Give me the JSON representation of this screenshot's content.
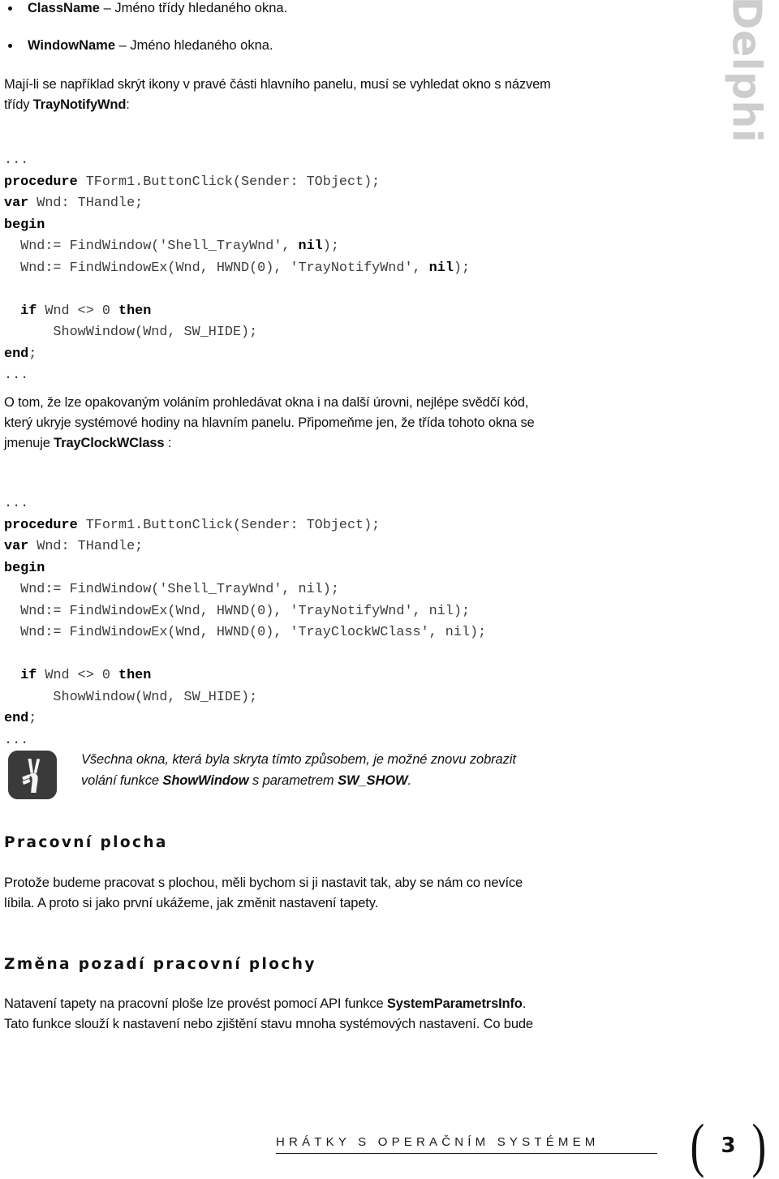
{
  "brand": {
    "vertical_label": "Delphi",
    "color": "#cdcdcd"
  },
  "bullets": [
    {
      "term": "ClassName",
      "dash": " – ",
      "desc": "Jméno třídy hledaného okna."
    },
    {
      "term": "WindowName",
      "dash": " – ",
      "desc": "Jméno hledaného okna."
    }
  ],
  "intro": {
    "line1": "Mají-li se například skrýt ikony v pravé části hlavního panelu, musí se vyhledat okno s názvem",
    "line2_prefix": "třídy ",
    "line2_term": "TrayNotifyWnd",
    "line2_suffix": ":"
  },
  "code_block_1": {
    "ellipsis_top": "...",
    "lines": [
      {
        "bold": "procedure",
        "rest": " TForm1.ButtonClick(Sender: TObject);"
      },
      {
        "bold": "var",
        "rest": " Wnd: THandle;"
      },
      {
        "bold": "begin",
        "rest": ""
      },
      {
        "bold": "",
        "rest": "  Wnd:= FindWindow('Shell_TrayWnd', ",
        "bold2": "nil",
        "rest2": ");"
      },
      {
        "bold": "",
        "rest": "  Wnd:= FindWindowEx(Wnd, HWND(0), 'TrayNotifyWnd', ",
        "bold2": "nil",
        "rest2": ");"
      },
      {
        "bold": "",
        "rest": ""
      },
      {
        "bold": "  if",
        "rest": " Wnd <> 0 ",
        "bold2": "then",
        "rest2": ""
      },
      {
        "bold": "",
        "rest": "      ShowWindow(Wnd, SW_HIDE);"
      },
      {
        "bold": "end",
        "rest": ";"
      }
    ],
    "ellipsis_bottom": "..."
  },
  "middle_paragraph": {
    "line1": "O tom, že lze opakovaným voláním prohledávat okna i na další úrovni, nejlépe svědčí kód,",
    "line2": "který ukryje systémové hodiny na hlavním panelu. Připomeňme jen, že třída tohoto okna se",
    "line3_prefix": "jmenuje ",
    "line3_term": "TrayClockWClass",
    "line3_suffix": " :"
  },
  "code_block_2": {
    "ellipsis_top": "...",
    "lines": [
      {
        "bold": "procedure",
        "rest": " TForm1.ButtonClick(Sender: TObject);"
      },
      {
        "bold": "var",
        "rest": " Wnd: THandle;"
      },
      {
        "bold": "begin",
        "rest": ""
      },
      {
        "bold": "",
        "rest": "  Wnd:= FindWindow('Shell_TrayWnd', nil);"
      },
      {
        "bold": "",
        "rest": "  Wnd:= FindWindowEx(Wnd, HWND(0), 'TrayNotifyWnd', nil);"
      },
      {
        "bold": "",
        "rest": "  Wnd:= FindWindowEx(Wnd, HWND(0), 'TrayClockWClass', nil);"
      },
      {
        "bold": "",
        "rest": ""
      },
      {
        "bold": "  if",
        "rest": " Wnd <> 0 ",
        "bold2": "then",
        "rest2": ""
      },
      {
        "bold": "",
        "rest": "      ShowWindow(Wnd, SW_HIDE);"
      },
      {
        "bold": "end",
        "rest": ";"
      }
    ],
    "ellipsis_bottom": "..."
  },
  "note": {
    "icon": "hand-victory-icon",
    "icon_bg": "#3a3a3a",
    "line1": "Všechna okna, která byla skryta tímto způsobem, je možné znovu zobrazit",
    "line2_prefix": "volání funkce ",
    "line2_term1": "ShowWindow",
    "line2_mid": " s parametrem ",
    "line2_term2": "SW_SHOW",
    "line2_suffix": "."
  },
  "section_1": {
    "heading": "Pracovní plocha",
    "line1": "Protože budeme pracovat s plochou, měli bychom si ji nastavit tak, aby se nám co nevíce",
    "line2": "líbila. A proto si jako první ukážeme, jak změnit nastavení tapety."
  },
  "section_2": {
    "heading": "Změna pozadí pracovní plochy",
    "line1_prefix": "Natavení tapety na pracovní ploše lze provést pomocí API funkce ",
    "line1_term": "SystemParametrsInfo",
    "line1_suffix": ".",
    "line2": "Tato funkce slouží k nastavení nebo zjištění stavu mnoha systémových nastavení. Co bude"
  },
  "footer": {
    "title": "HRÁTKY S OPERAČNÍM SYSTÉMEM",
    "bracket_left": "(",
    "page_number": "3",
    "bracket_right": ")"
  }
}
